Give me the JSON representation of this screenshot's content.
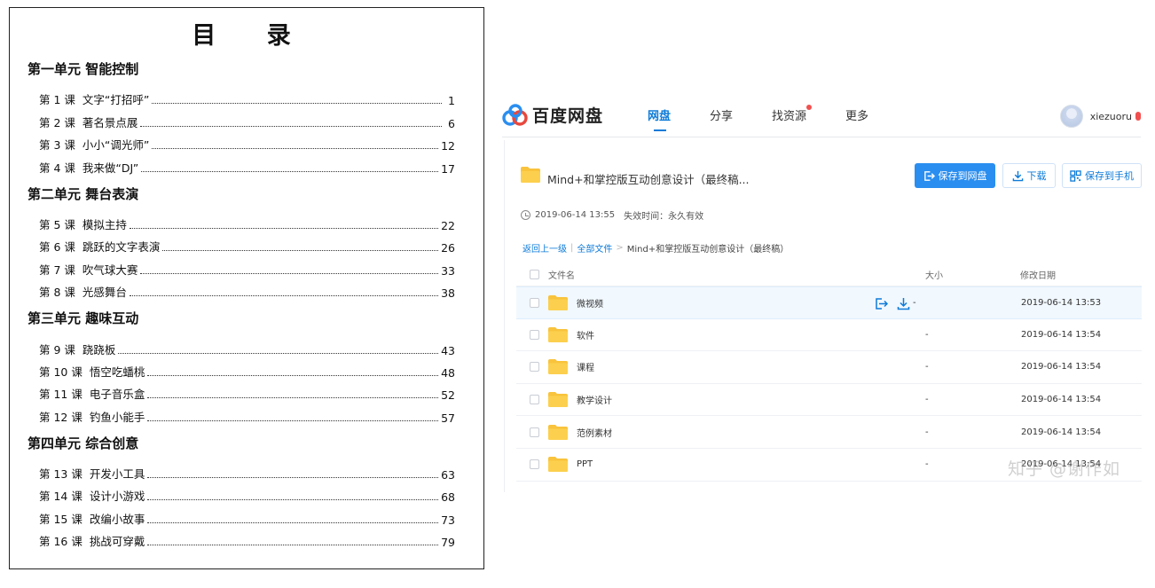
{
  "toc": {
    "title": "目 录",
    "units": [
      {
        "title": "第一单元  智能控制",
        "lessons": [
          {
            "num": "第 1 课",
            "name": "文字“打招呼”",
            "page": "1"
          },
          {
            "num": "第 2 课",
            "name": "著名景点展",
            "page": "6"
          },
          {
            "num": "第 3 课",
            "name": "小小“调光师”",
            "page": "12"
          },
          {
            "num": "第 4 课",
            "name": "我来做“DJ”",
            "page": "17"
          }
        ]
      },
      {
        "title": "第二单元  舞台表演",
        "lessons": [
          {
            "num": "第 5 课",
            "name": "模拟主持",
            "page": "22"
          },
          {
            "num": "第 6 课",
            "name": "跳跃的文字表演",
            "page": "26"
          },
          {
            "num": "第 7 课",
            "name": "吹气球大赛",
            "page": "33"
          },
          {
            "num": "第 8 课",
            "name": "光感舞台",
            "page": "38"
          }
        ]
      },
      {
        "title": "第三单元  趣味互动",
        "lessons": [
          {
            "num": "第 9 课",
            "name": "跷跷板",
            "page": "43"
          },
          {
            "num": "第 10 课",
            "name": "悟空吃蟠桃",
            "page": "48"
          },
          {
            "num": "第 11 课",
            "name": "电子音乐盒",
            "page": "52"
          },
          {
            "num": "第 12 课",
            "name": "钓鱼小能手",
            "page": "57"
          }
        ]
      },
      {
        "title": "第四单元  综合创意",
        "lessons": [
          {
            "num": "第 13 课",
            "name": "开发小工具",
            "page": "63"
          },
          {
            "num": "第 14 课",
            "name": "设计小游戏",
            "page": "68"
          },
          {
            "num": "第 15 课",
            "name": "改编小故事",
            "page": "73"
          },
          {
            "num": "第 16 课",
            "name": "挑战可穿戴",
            "page": "79"
          }
        ]
      }
    ]
  },
  "pan": {
    "logo_text": "百度网盘",
    "nav": [
      {
        "label": "网盘",
        "active": true
      },
      {
        "label": "分享",
        "active": false
      },
      {
        "label": "找资源",
        "active": false,
        "dot": true
      },
      {
        "label": "更多",
        "active": false
      }
    ],
    "user": {
      "name": "xiezuoru"
    },
    "share_title": "Mind+和掌控版互动创意设计（最终稿...",
    "buttons": {
      "save": "保存到网盘",
      "download": "下载",
      "phone": "保存到手机"
    },
    "meta": {
      "time": "2019-06-14 13:55",
      "expire_label": "失效时间：",
      "expire_value": "永久有效"
    },
    "breadcrumb": {
      "back": "返回上一级",
      "sep1": "|",
      "all": "全部文件",
      "sep2": ">",
      "current": "Mind+和掌控版互动创意设计（最终稿）"
    },
    "columns": {
      "name": "文件名",
      "size": "大小",
      "date": "修改日期"
    },
    "files": [
      {
        "name": "微视频",
        "size": "-",
        "date": "2019-06-14 13:53",
        "hover": true
      },
      {
        "name": "软件",
        "size": "-",
        "date": "2019-06-14 13:54"
      },
      {
        "name": "课程",
        "size": "-",
        "date": "2019-06-14 13:54"
      },
      {
        "name": "教学设计",
        "size": "-",
        "date": "2019-06-14 13:54"
      },
      {
        "name": "范例素材",
        "size": "-",
        "date": "2019-06-14 13:54"
      },
      {
        "name": "PPT",
        "size": "-",
        "date": "2019-06-14 13:54"
      }
    ],
    "colors": {
      "accent": "#2a8ef0",
      "link": "#0e7bd8",
      "folder": "#f9c33c"
    }
  },
  "watermark": "知乎 @谢作如"
}
